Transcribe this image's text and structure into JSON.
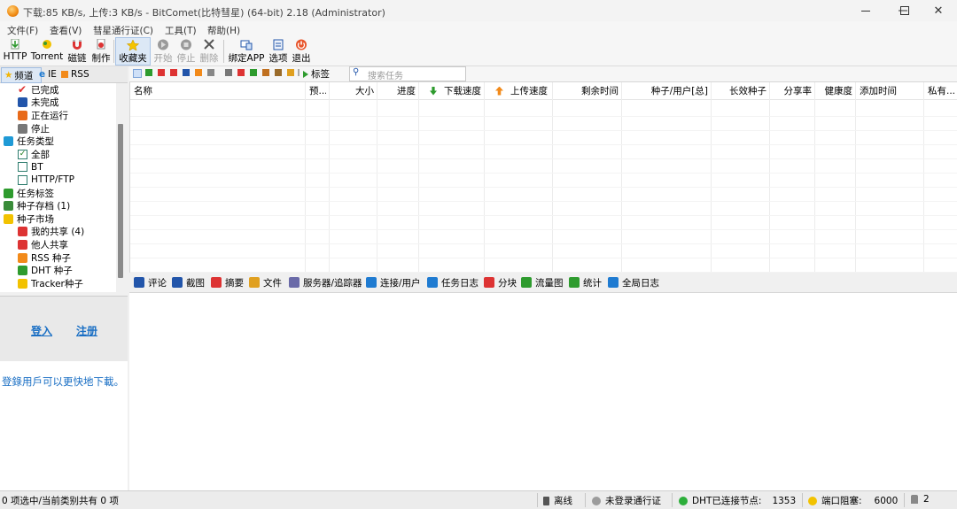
{
  "window": {
    "title": "下载:85 KB/s, 上传:3 KB/s - BitComet(比特彗星) (64-bit) 2.18 (Administrator)"
  },
  "menu": [
    "文件(F)",
    "查看(V)",
    "彗星通行证(C)",
    "工具(T)",
    "帮助(H)"
  ],
  "toolbar": [
    {
      "label": "HTTP",
      "icon": "http-download-icon",
      "disabled": false
    },
    {
      "label": "Torrent",
      "icon": "torrent-icon",
      "disabled": false
    },
    {
      "label": "磁链",
      "icon": "magnet-icon",
      "disabled": false
    },
    {
      "label": "制作",
      "icon": "make-torrent-icon",
      "disabled": false
    },
    {
      "label": "收藏夹",
      "icon": "favorites-star-icon",
      "disabled": false,
      "active": true
    },
    {
      "label": "开始",
      "icon": "start-icon",
      "disabled": true
    },
    {
      "label": "停止",
      "icon": "stop-icon",
      "disabled": true
    },
    {
      "label": "删除",
      "icon": "delete-icon",
      "disabled": true
    },
    {
      "label": "绑定APP",
      "icon": "bind-app-icon",
      "disabled": false
    },
    {
      "label": "选项",
      "icon": "options-icon",
      "disabled": false
    },
    {
      "label": "退出",
      "icon": "exit-icon",
      "disabled": false
    }
  ],
  "left_tabs": [
    {
      "label": "频道",
      "icon": "star-icon",
      "active": true
    },
    {
      "label": "IE",
      "icon": "ie-icon",
      "active": false
    },
    {
      "label": "RSS",
      "icon": "rss-icon",
      "active": false
    }
  ],
  "tree": [
    {
      "label": "已完成",
      "icon": "check-icon",
      "indent": 1
    },
    {
      "label": "未完成",
      "icon": "incomplete-icon",
      "indent": 1
    },
    {
      "label": "正在运行",
      "icon": "running-icon",
      "indent": 1
    },
    {
      "label": "停止",
      "icon": "stopped-icon",
      "indent": 1
    },
    {
      "label": "任务类型",
      "icon": "filter-icon",
      "indent": 0
    },
    {
      "label": "全部",
      "icon": "checkbox-checked-icon",
      "indent": 1
    },
    {
      "label": "BT",
      "icon": "checkbox-icon",
      "indent": 1
    },
    {
      "label": "HTTP/FTP",
      "icon": "checkbox-icon",
      "indent": 1
    },
    {
      "label": "任务标签",
      "icon": "tag-icon",
      "indent": 0
    },
    {
      "label": "种子存档 (1)",
      "icon": "archive-icon",
      "indent": 0
    },
    {
      "label": "种子市场",
      "icon": "folder-icon",
      "indent": 0
    },
    {
      "label": "我的共享 (4)",
      "icon": "my-share-icon",
      "indent": 1
    },
    {
      "label": "他人共享",
      "icon": "others-share-icon",
      "indent": 1
    },
    {
      "label": "RSS 种子",
      "icon": "rss-icon",
      "indent": 1
    },
    {
      "label": "DHT 种子",
      "icon": "dht-icon",
      "indent": 1
    },
    {
      "label": "Tracker种子",
      "icon": "tracker-icon",
      "indent": 1
    }
  ],
  "login": {
    "login": "登入",
    "register": "注册"
  },
  "promo": "登錄用戶可以更快地下載。",
  "subtoolbar": {
    "tag_label": "标签",
    "search_placeholder": "搜索任务"
  },
  "columns": [
    "名称",
    "预...",
    "大小",
    "进度",
    "下载速度",
    "上传速度",
    "剩余时间",
    "种子/用户[总]",
    "长效种子",
    "分享率",
    "健康度",
    "添加时间",
    "私有..."
  ],
  "bottom_tabs": [
    "评论",
    "截图",
    "摘要",
    "文件",
    "服务器/追踪器",
    "连接/用户",
    "任务日志",
    "分块",
    "流量图",
    "统计",
    "全局日志"
  ],
  "status": {
    "selection": "0 项选中/当前类别共有 0 项",
    "offline": "离线",
    "passport": "未登录通行证",
    "dht": "DHT已连接节点:",
    "dht_count": "1353",
    "port": "端口阻塞:",
    "port_value": "6000",
    "count": "2"
  },
  "colors": {
    "accent": "#1a6fc4",
    "dht_green": "#2cae3a",
    "port_yellow": "#f2c200"
  }
}
